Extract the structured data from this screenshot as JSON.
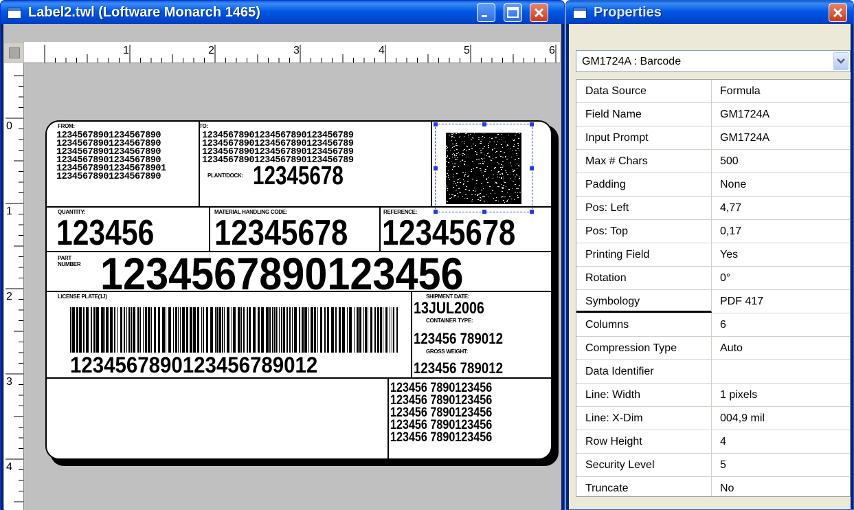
{
  "label_window": {
    "title": "Label2.twl (Loftware Monarch 1465)",
    "ruler_h": [
      "1",
      "2",
      "3",
      "4",
      "5",
      "6"
    ],
    "ruler_v": [
      "0",
      "1",
      "2",
      "3",
      "4"
    ]
  },
  "label": {
    "from_caption": "FROM:",
    "to_caption": "TO:",
    "from_lines": [
      "12345678901234567890",
      "12345678901234567890",
      "12345678901234567890",
      "12345678901234567890",
      "123456789012345678901",
      "12345678901234567890"
    ],
    "to_lines": [
      "12345678901234567890123456789",
      "12345678901234567890123456789",
      "12345678901234567890123456789",
      "12345678901234567890123456789"
    ],
    "plant_dock_caption": "PLANT/DOCK:",
    "plant_dock_value": "12345678",
    "quantity_caption": "QUANTITY:",
    "quantity_value": "123456",
    "mhc_caption": "MATERIAL HANDLING CODE:",
    "mhc_value": "12345678",
    "reference_caption": "REFERENCE:",
    "reference_value": "12345678",
    "part_caption_1": "PART",
    "part_caption_2": "NUMBER",
    "part_value": "1234567890123456",
    "license_caption": "LICENSE PLATE(1J)",
    "license_value": "1234567890123456789012",
    "shipment_caption": "SHIPMENT DATE:",
    "shipment_value": "13JUL2006",
    "container_caption": "CONTAINER TYPE:",
    "container_value": "123456 789012",
    "gross_caption": "GROSS WEIGHT:",
    "gross_value": "123456 789012",
    "bottom_lines": [
      "123456 7890123456",
      "123456 7890123456",
      "123456 7890123456",
      "123456 7890123456",
      "123456 7890123456"
    ]
  },
  "properties_window": {
    "title": "Properties",
    "selected_object": "GM1724A : Barcode",
    "rows": [
      {
        "name": "Data Source",
        "value": "Formula"
      },
      {
        "name": "Field Name",
        "value": "GM1724A"
      },
      {
        "name": "Input Prompt",
        "value": "GM1724A"
      },
      {
        "name": "Max # Chars",
        "value": "500"
      },
      {
        "name": "Padding",
        "value": "None"
      },
      {
        "name": "Pos: Left",
        "value": "4,77"
      },
      {
        "name": "Pos: Top",
        "value": "0,17"
      },
      {
        "name": "Printing Field",
        "value": "Yes"
      },
      {
        "name": "Rotation",
        "value": "0°"
      },
      {
        "name": "Symbology",
        "value": "PDF 417"
      },
      {
        "name": "Columns",
        "value": "6"
      },
      {
        "name": "Compression Type",
        "value": "Auto"
      },
      {
        "name": "Data Identifier",
        "value": ""
      },
      {
        "name": "Line:  Width",
        "value": " 1 pixels"
      },
      {
        "name": "Line: X-Dim",
        "value": "004,9 mil"
      },
      {
        "name": "Row Height",
        "value": "4"
      },
      {
        "name": "Security Level",
        "value": "5"
      },
      {
        "name": "Truncate",
        "value": "No"
      }
    ]
  },
  "colors": {
    "title_bar": "#0054e3",
    "close_button": "#d4502f",
    "selection": "#1f3fd6"
  }
}
